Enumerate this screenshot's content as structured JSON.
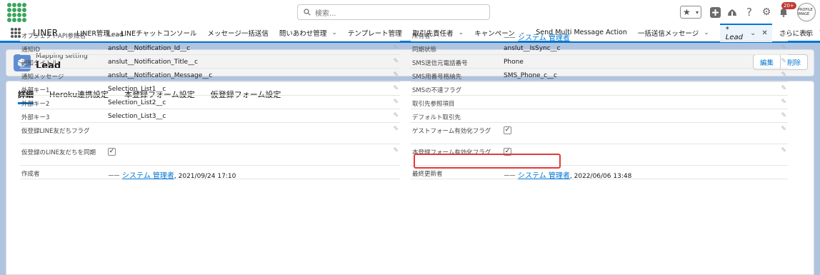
{
  "header": {
    "search_placeholder": "検索...",
    "notification_count": "20+",
    "avatar_text": "PROFILE IMAGE"
  },
  "nav": {
    "app_name": "LINER",
    "items": [
      {
        "label": "LINER管理",
        "chevron": false
      },
      {
        "label": "LINEチャットコンソール",
        "chevron": false
      },
      {
        "label": "メッセージ一括送信",
        "chevron": false
      },
      {
        "label": "問いあわせ管理",
        "chevron": true
      },
      {
        "label": "テンプレート管理",
        "chevron": false
      },
      {
        "label": "取引先責任者",
        "chevron": true
      },
      {
        "label": "キャンペーン",
        "chevron": true
      },
      {
        "label": "Send Multi Message Action",
        "chevron": false
      },
      {
        "label": "一括送信メッセージ",
        "chevron": true
      }
    ],
    "active_tab": "* Lead",
    "more_label": "さらに表示"
  },
  "record": {
    "subtitle": "Mapping setting",
    "title": "Lead",
    "edit_label": "編集",
    "delete_label": "削除"
  },
  "tabs": [
    {
      "label": "詳細",
      "active": true
    },
    {
      "label": "Heroku連携設定",
      "active": false
    },
    {
      "label": "本登録フォーム設定",
      "active": false
    },
    {
      "label": "仮登録フォーム設定",
      "active": false
    }
  ],
  "left_fields": [
    {
      "label": "オブジェクトAPI参照名",
      "value": "Lead"
    },
    {
      "label": "通知ID",
      "value": "anslut__Notification_Id__c"
    },
    {
      "label": "通知タイトル",
      "value": "anslut__Notification_Title__c"
    },
    {
      "label": "通知メッセージ",
      "value": "anslut__Notification_Message__c"
    },
    {
      "label": "外部キー1",
      "value": "Selection_List1__c"
    },
    {
      "label": "外部キー2",
      "value": "Selection_List2__c"
    },
    {
      "label": "外部キー3",
      "value": "Selection_List3__c"
    },
    {
      "label": "仮登録LINE友だちフラグ",
      "value": ""
    },
    {
      "label": "仮登録のLINE友だちを同期",
      "value": ""
    },
    {
      "label": "作成者",
      "value": "システム 管理者",
      "suffix": ", 2021/09/24 17:10"
    }
  ],
  "right_fields": [
    {
      "label": "所有者",
      "value": "システム 管理者"
    },
    {
      "label": "同期状態",
      "value": "anslut__IsSync__c"
    },
    {
      "label": "SMS送信元電話番号",
      "value": "Phone"
    },
    {
      "label": "SMS用番号格納先",
      "value": "SMS_Phone_c__c"
    },
    {
      "label": "SMSの不達フラグ",
      "value": ""
    },
    {
      "label": "取引先参照項目",
      "value": ""
    },
    {
      "label": "デフォルト取引先",
      "value": ""
    },
    {
      "label": "ゲストフォーム有効化フラグ",
      "value": ""
    },
    {
      "label": "本登録フォーム有効化フラグ",
      "value": ""
    },
    {
      "label": "最終更新者",
      "value": "システム 管理者",
      "suffix": ", 2022/06/06 13:48"
    }
  ],
  "checked_mark": "✓",
  "dash_mark": "ーー"
}
